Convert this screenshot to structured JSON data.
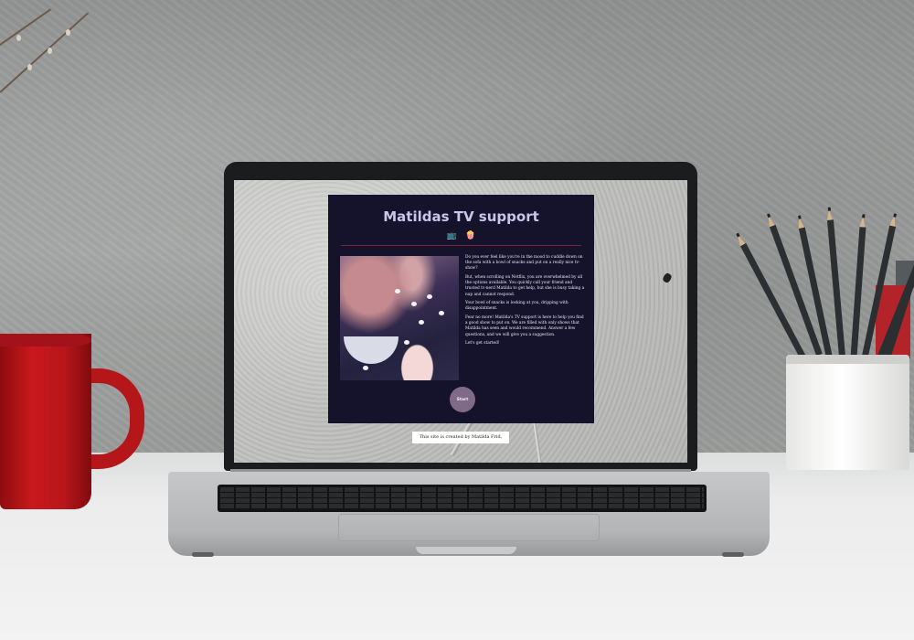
{
  "app": {
    "title": "Matildas TV support",
    "emoji": [
      "📺",
      "🍿"
    ]
  },
  "intro": {
    "paragraphs": [
      "Do you ever feel like you're in the mood to cuddle down on the sofa with a bowl of snacks and put on a really nice tv-show?",
      "But, when scrolling on Netflix, you are overwhelmed by all the options available. You quickly call your friend and trusted tv-nerd Matilda to get help, but she is busy taking a nap and cannot respond.",
      "Your bowl of snacks is looking at you, dripping with disappointment.",
      "Fear no more! Matilda's TV support is here to help you find a good show to put on. We are filled with only shows that Matilda has seen and would recommend. Answer a few questions, and we will give you a suggestion.",
      "Let's get started!"
    ]
  },
  "start_button": {
    "label": "Start"
  },
  "footer": {
    "credit": "This site is created by Matilda Frid."
  },
  "icons": {
    "tv": "television-icon",
    "popcorn": "popcorn-icon"
  },
  "colors": {
    "card_bg": "#14132b",
    "title": "#c9c6ea",
    "divider": "#7a2232",
    "button": "#816a88"
  }
}
